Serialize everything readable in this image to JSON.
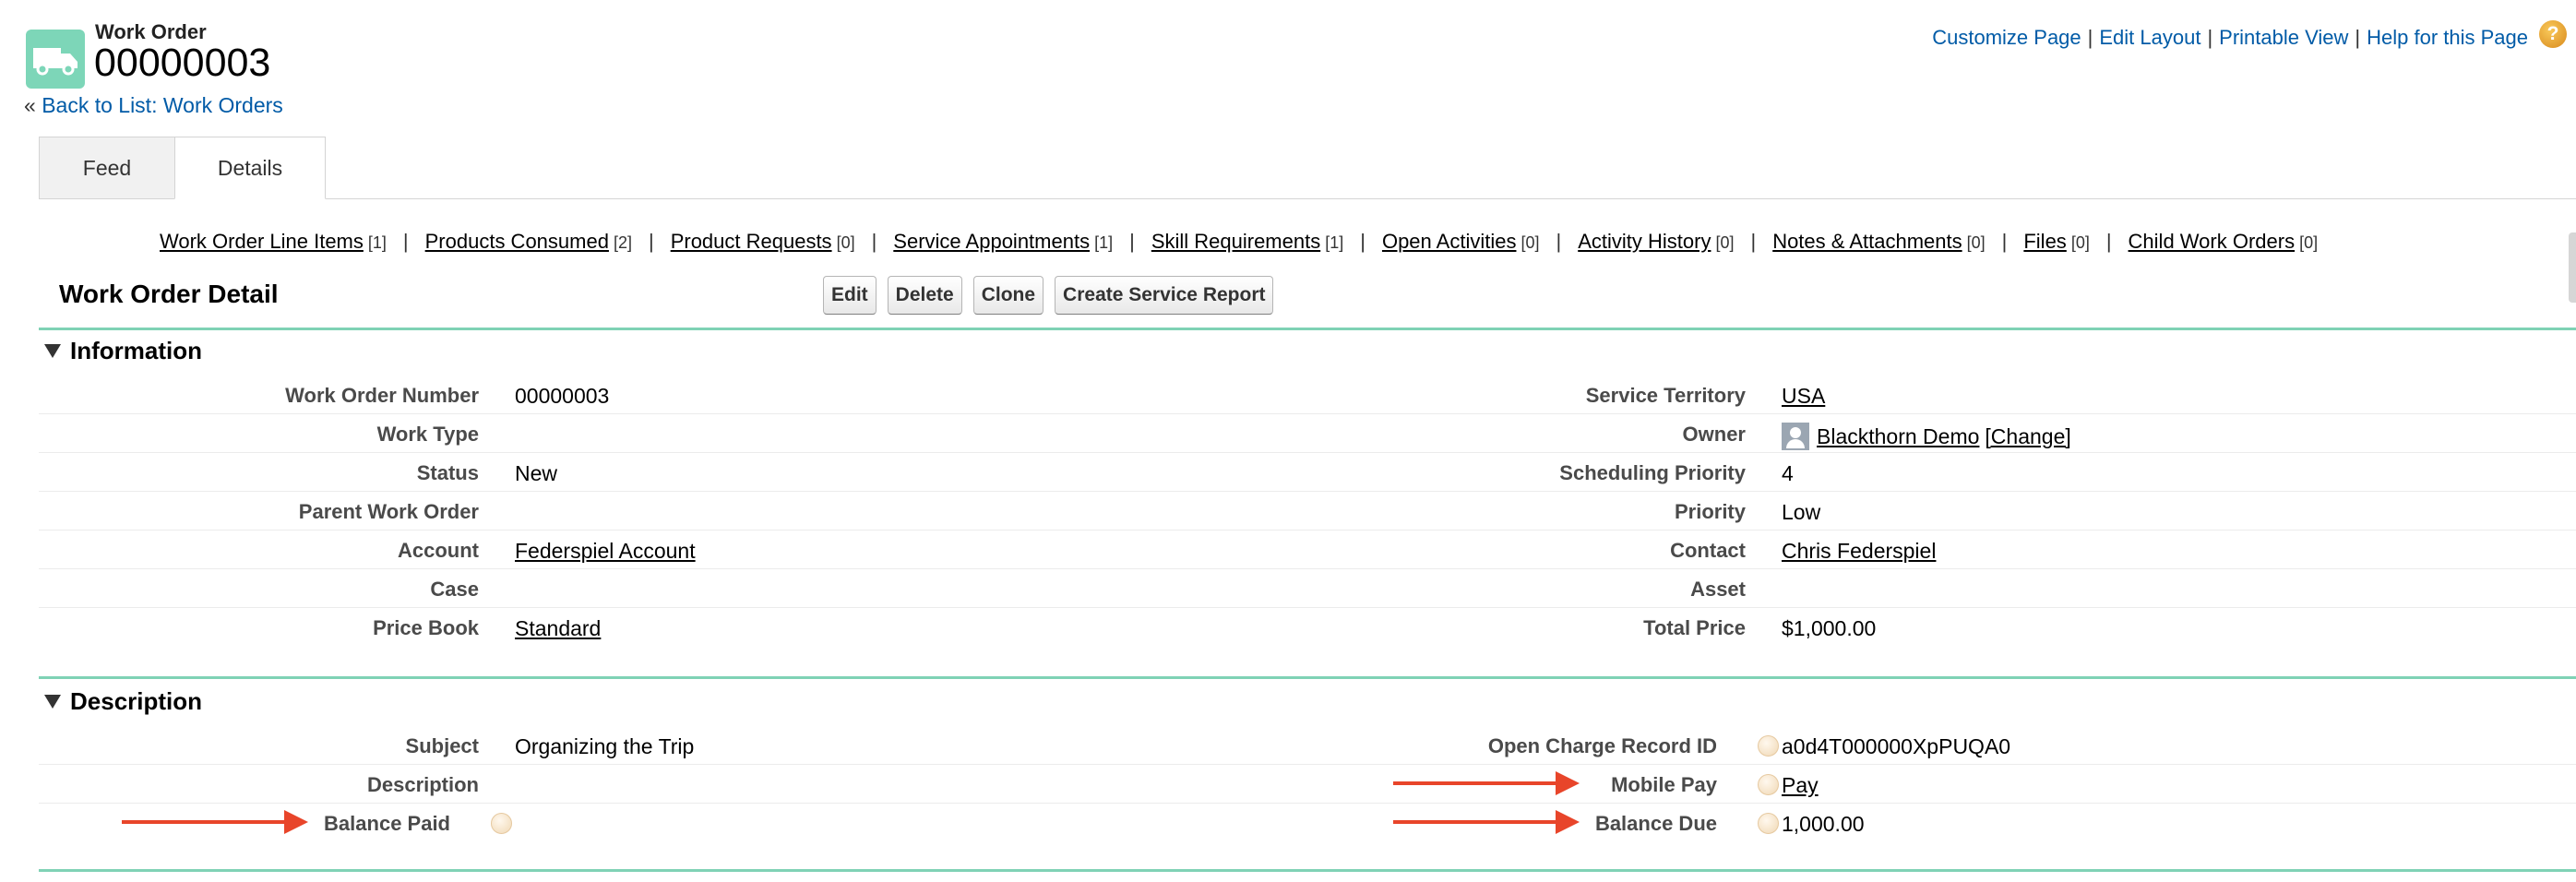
{
  "header": {
    "object_type": "Work Order",
    "record_name": "00000003",
    "back_prefix": "«",
    "back_link": "Back to List: Work Orders",
    "top_links": [
      "Customize Page",
      "Edit Layout",
      "Printable View",
      "Help for this Page"
    ],
    "top_sep": "|",
    "help_glyph": "?"
  },
  "tabs": [
    {
      "label": "Feed",
      "active": false
    },
    {
      "label": "Details",
      "active": true
    }
  ],
  "related_lists": [
    {
      "label": "Work Order Line Items",
      "count": "[1]"
    },
    {
      "label": "Products Consumed",
      "count": "[2]"
    },
    {
      "label": "Product Requests",
      "count": "[0]"
    },
    {
      "label": "Service Appointments",
      "count": "[1]"
    },
    {
      "label": "Skill Requirements",
      "count": "[1]"
    },
    {
      "label": "Open Activities",
      "count": "[0]"
    },
    {
      "label": "Activity History",
      "count": "[0]"
    },
    {
      "label": "Notes & Attachments",
      "count": "[0]"
    },
    {
      "label": "Files",
      "count": "[0]"
    },
    {
      "label": "Child Work Orders",
      "count": "[0]"
    }
  ],
  "related_sep": "|",
  "detail": {
    "title": "Work Order Detail",
    "buttons": [
      "Edit",
      "Delete",
      "Clone",
      "Create Service Report"
    ]
  },
  "information": {
    "title": "Information",
    "rows": [
      {
        "left_label": "Work Order Number",
        "left_value": "00000003",
        "right_label": "Service Territory",
        "right_value": "USA"
      },
      {
        "left_label": "Work Type",
        "left_value": "",
        "right_label": "Owner",
        "right_value": "Blackthorn Demo",
        "right_extra": "[Change]"
      },
      {
        "left_label": "Status",
        "left_value": "New",
        "right_label": "Scheduling Priority",
        "right_value": "4"
      },
      {
        "left_label": "Parent Work Order",
        "left_value": "",
        "right_label": "Priority",
        "right_value": "Low"
      },
      {
        "left_label": "Account",
        "left_value": "Federspiel Account",
        "right_label": "Contact",
        "right_value": "Chris Federspiel"
      },
      {
        "left_label": "Case",
        "left_value": "",
        "right_label": "Asset",
        "right_value": ""
      },
      {
        "left_label": "Price Book",
        "left_value": "Standard",
        "right_label": "Total Price",
        "right_value": "$1,000.00"
      }
    ]
  },
  "description": {
    "title": "Description",
    "rows": [
      {
        "left_label": "Subject",
        "left_value": "Organizing the Trip",
        "right_label": "Open Charge Record ID",
        "right_value": "a0d4T000000XpPUQA0"
      },
      {
        "left_label": "Description",
        "left_value": "",
        "right_label": "Mobile Pay",
        "right_value": "Pay"
      },
      {
        "left_label": "Balance Paid",
        "left_value": "",
        "right_label": "Balance Due",
        "right_value": "1,000.00"
      }
    ]
  },
  "colors": {
    "accent_green": "#7fd2b5",
    "link_blue": "#015ba7",
    "annotation_red": "#e8452a"
  },
  "icons": [
    "truck-icon",
    "help-icon",
    "collapse-triangle-icon",
    "field-help-icon",
    "user-avatar-icon",
    "red-arrow-annotation"
  ]
}
